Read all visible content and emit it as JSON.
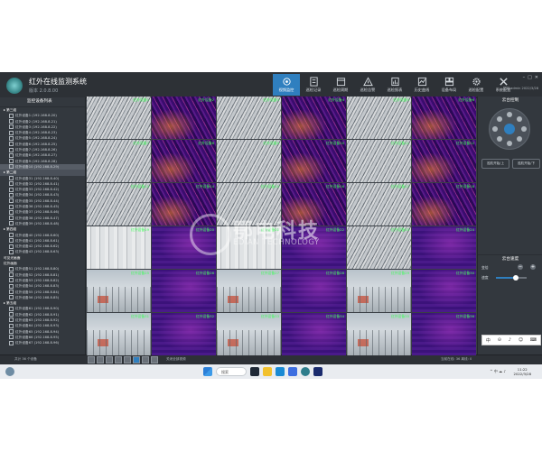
{
  "app": {
    "title": "红外在线监测系统",
    "version": "版本 2.0.8.00",
    "user_line": "您好 admin 2022/3/28",
    "nav": [
      {
        "label": "视频监控",
        "icon": "camera-icon",
        "active": true
      },
      {
        "label": "巡检记录",
        "icon": "record-icon",
        "active": false
      },
      {
        "label": "巡检周期",
        "icon": "calendar-icon",
        "active": false
      },
      {
        "label": "巡检告警",
        "icon": "alarm-icon",
        "active": false
      },
      {
        "label": "巡检报表",
        "icon": "report-icon",
        "active": false
      },
      {
        "label": "历史曲线",
        "icon": "chart-icon",
        "active": false
      },
      {
        "label": "设备布局",
        "icon": "layout-icon",
        "active": false
      },
      {
        "label": "巡检配置",
        "icon": "gear-icon",
        "active": false
      },
      {
        "label": "系统配置",
        "icon": "tools-icon",
        "active": false
      }
    ]
  },
  "tree": {
    "title": "监控设备列表",
    "rows": [
      {
        "kind": "group",
        "label": "▸ 第三组",
        "sel": false
      },
      {
        "kind": "item",
        "label": "红外设备1 (192.168.8.20)",
        "sel": false
      },
      {
        "kind": "item",
        "label": "红外设备2 (192.168.8.21)",
        "sel": false
      },
      {
        "kind": "item",
        "label": "红外设备3 (192.168.8.22)",
        "sel": false
      },
      {
        "kind": "item",
        "label": "红外设备4 (192.168.8.23)",
        "sel": false
      },
      {
        "kind": "item",
        "label": "红外设备5 (192.168.8.24)",
        "sel": false
      },
      {
        "kind": "item",
        "label": "红外设备6 (192.168.8.25)",
        "sel": false
      },
      {
        "kind": "item",
        "label": "红外设备7 (192.168.8.26)",
        "sel": false
      },
      {
        "kind": "item",
        "label": "红外设备8 (192.168.8.27)",
        "sel": false
      },
      {
        "kind": "item",
        "label": "红外设备9 (192.168.8.28)",
        "sel": false
      },
      {
        "kind": "item",
        "label": "红外设备10 (192.168.8.29)",
        "sel": true
      },
      {
        "kind": "group",
        "label": "▸ 第二组",
        "sel": true
      },
      {
        "kind": "item",
        "label": "红外设备31 (192.168.8.40)",
        "sel": false
      },
      {
        "kind": "item",
        "label": "红外设备32 (192.168.8.41)",
        "sel": false
      },
      {
        "kind": "item",
        "label": "红外设备33 (192.168.8.42)",
        "sel": false
      },
      {
        "kind": "item",
        "label": "红外设备34 (192.168.8.43)",
        "sel": false
      },
      {
        "kind": "item",
        "label": "红外设备35 (192.168.8.44)",
        "sel": false
      },
      {
        "kind": "item",
        "label": "红外设备36 (192.168.8.45)",
        "sel": false
      },
      {
        "kind": "item",
        "label": "红外设备37 (192.168.8.46)",
        "sel": false
      },
      {
        "kind": "item",
        "label": "红外设备38 (192.168.8.47)",
        "sel": false
      },
      {
        "kind": "item",
        "label": "红外设备39 (192.168.8.48)",
        "sel": false
      },
      {
        "kind": "group",
        "label": "▸ 第四组",
        "sel": false
      },
      {
        "kind": "item",
        "label": "红外设备40 (192.168.8.60)",
        "sel": false
      },
      {
        "kind": "item",
        "label": "红外设备41 (192.168.8.61)",
        "sel": false
      },
      {
        "kind": "item",
        "label": "红外设备42 (192.168.8.62)",
        "sel": false
      },
      {
        "kind": "item",
        "label": "红外设备43 (192.168.8.63)",
        "sel": false
      },
      {
        "kind": "group",
        "label": "  可见光画面",
        "sel": false
      },
      {
        "kind": "group",
        "label": "  红外画面",
        "sel": false
      },
      {
        "kind": "item",
        "label": "红外设备51 (192.168.8.80)",
        "sel": false
      },
      {
        "kind": "item",
        "label": "红外设备52 (192.168.8.81)",
        "sel": false
      },
      {
        "kind": "item",
        "label": "红外设备53 (192.168.8.82)",
        "sel": false
      },
      {
        "kind": "item",
        "label": "红外设备54 (192.168.8.83)",
        "sel": false
      },
      {
        "kind": "item",
        "label": "红外设备55 (192.168.8.84)",
        "sel": false
      },
      {
        "kind": "item",
        "label": "红外设备56 (192.168.8.85)",
        "sel": false
      },
      {
        "kind": "group",
        "label": "▸ 第五组",
        "sel": false
      },
      {
        "kind": "item",
        "label": "红外设备61 (192.168.8.90)",
        "sel": false
      },
      {
        "kind": "item",
        "label": "红外设备62 (192.168.8.91)",
        "sel": false
      },
      {
        "kind": "item",
        "label": "红外设备63 (192.168.8.92)",
        "sel": false
      },
      {
        "kind": "item",
        "label": "红外设备64 (192.168.8.93)",
        "sel": false
      },
      {
        "kind": "item",
        "label": "红外设备65 (192.168.8.94)",
        "sel": false
      },
      {
        "kind": "item",
        "label": "红外设备66 (192.168.8.95)",
        "sel": false
      },
      {
        "kind": "item",
        "label": "红外设备67 (192.168.8.96)",
        "sel": false
      }
    ]
  },
  "grid": {
    "cells": [
      {
        "type": "vis",
        "label": "红外设备1"
      },
      {
        "type": "ir",
        "label": "红外设备2"
      },
      {
        "type": "vis",
        "label": "红外设备3"
      },
      {
        "type": "ir",
        "label": "红外设备4"
      },
      {
        "type": "vis",
        "label": "红外设备5"
      },
      {
        "type": "ir",
        "label": "红外设备6"
      },
      {
        "type": "vis",
        "label": "红外设备7"
      },
      {
        "type": "ir",
        "label": "红外设备8"
      },
      {
        "type": "vis",
        "label": "红外设备9"
      },
      {
        "type": "ir",
        "label": "红外设备10"
      },
      {
        "type": "vis",
        "label": "红外设备11"
      },
      {
        "type": "ir",
        "label": "红外设备12"
      },
      {
        "type": "vis",
        "label": "红外设备13"
      },
      {
        "type": "ir",
        "label": "红外设备14"
      },
      {
        "type": "vis",
        "label": "红外设备15"
      },
      {
        "type": "ir",
        "label": "红外设备16"
      },
      {
        "type": "vis",
        "label": "红外设备17"
      },
      {
        "type": "ir",
        "label": "红外设备18"
      },
      {
        "type": "vis2",
        "label": "红外设备19"
      },
      {
        "type": "ir2",
        "label": "红外设备20"
      },
      {
        "type": "vis2",
        "label": "红外设备21"
      },
      {
        "type": "ir2",
        "label": "红外设备22"
      },
      {
        "type": "vis",
        "label": "红外设备23"
      },
      {
        "type": "ir2",
        "label": "红外设备24"
      },
      {
        "type": "vis3",
        "label": "红外设备25"
      },
      {
        "type": "ir2",
        "label": "红外设备26"
      },
      {
        "type": "vis3",
        "label": "红外设备27"
      },
      {
        "type": "ir2",
        "label": "红外设备28"
      },
      {
        "type": "vis3",
        "label": "红外设备29"
      },
      {
        "type": "ir2",
        "label": "红外设备30"
      },
      {
        "type": "vis3",
        "label": "红外设备31"
      },
      {
        "type": "ir2",
        "label": "红外设备32"
      },
      {
        "type": "vis3",
        "label": "红外设备33"
      },
      {
        "type": "ir2",
        "label": "红外设备34"
      },
      {
        "type": "vis3",
        "label": "红外设备35"
      },
      {
        "type": "ir2",
        "label": "红外设备36"
      }
    ]
  },
  "watermark": {
    "cn": "鄂电科技",
    "en": "EDIAN TECHNOLOGY"
  },
  "ptz": {
    "title": "云台控制",
    "btn_left": "巡航开始/上",
    "btn_right": "巡航开始/下",
    "section2_title": "云台速度",
    "row1_label": "变倍",
    "row2_label": "速度",
    "speed_level": 0.65
  },
  "ime": [
    "中",
    "⊝",
    "♪",
    "☺",
    "⌨"
  ],
  "bottombar": {
    "count": "共计 36 个设备",
    "layouts": [
      "1",
      "4",
      "9",
      "16",
      "25",
      "36",
      "1+5",
      "自定义"
    ],
    "mid": "关闭全部视频",
    "right": "当前在线: 36  离线: 0"
  },
  "taskbar": {
    "search": "搜索",
    "tray": "^  中  ☁  ♪",
    "time": "11:22",
    "date": "2022/3/28"
  }
}
